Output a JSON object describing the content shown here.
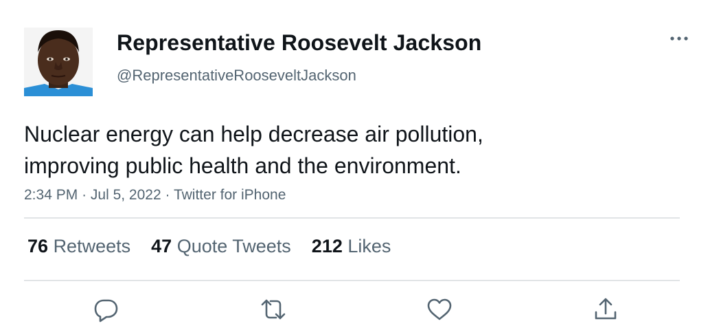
{
  "author": {
    "display_name": "Representative Roosevelt Jackson",
    "handle": "@RepresentativeRooseveltJackson"
  },
  "tweet": {
    "text_lines": [
      "Nuclear energy can help decrease air pollution,",
      "improving public health and the environment."
    ],
    "time": "2:34 PM",
    "separator": "·",
    "date": "Jul 5, 2022",
    "source": "Twitter for iPhone"
  },
  "stats": {
    "retweets": {
      "count": "76",
      "label": "Retweets"
    },
    "quote_tweets": {
      "count": "47",
      "label": "Quote Tweets"
    },
    "likes": {
      "count": "212",
      "label": "Likes"
    }
  },
  "actions": [
    "reply-icon",
    "retweet-icon",
    "like-icon",
    "share-icon"
  ],
  "colors": {
    "text_primary": "#0f1419",
    "text_secondary": "#536471",
    "divider": "#e1e4e6",
    "icon": "#536471"
  }
}
